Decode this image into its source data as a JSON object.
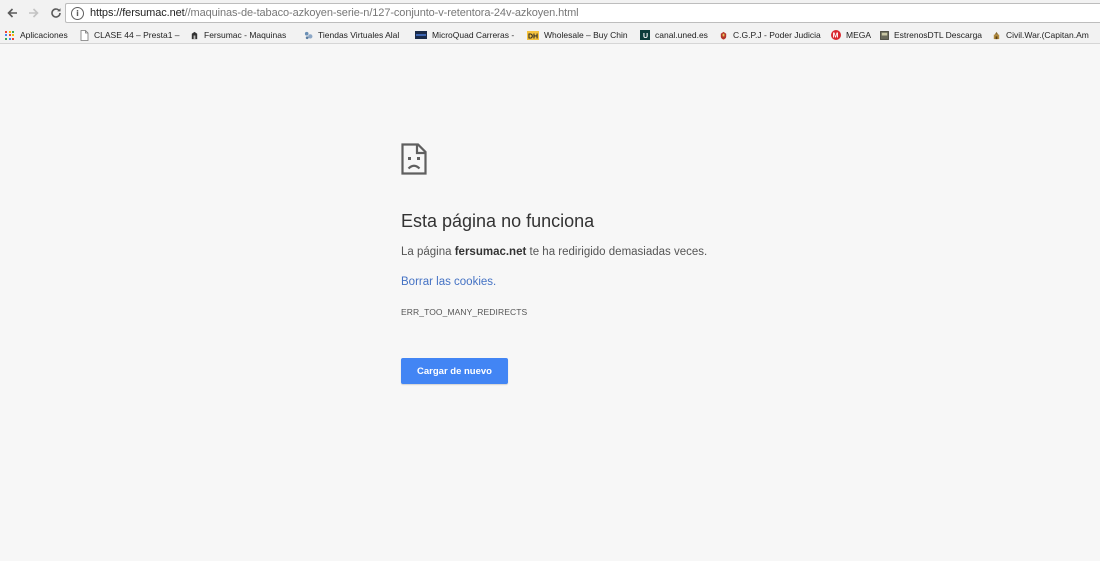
{
  "browser": {
    "back_icon": "arrow-left-icon",
    "forward_icon": "arrow-right-icon",
    "reload_icon": "reload-icon",
    "info_icon": "info-circle-icon",
    "url_host": "https://fersumac.net",
    "url_path": "//maquinas-de-tabaco-azkoyen-serie-n/127-conjunto-v-retentora-24v-azkoyen.html"
  },
  "bookmarks": {
    "items": [
      {
        "label": "Aplicaciones",
        "icon": "apps-grid-icon"
      },
      {
        "label": "CLASE 44 – Presta1 –",
        "icon": "page-icon"
      },
      {
        "label": "Fersumac - Maquinas",
        "icon": "site-icon"
      },
      {
        "label": "Tiendas Virtuales Alal",
        "icon": "site-icon"
      },
      {
        "label": "MicroQuad Carreras -",
        "icon": "site-icon"
      },
      {
        "label": "Wholesale – Buy Chin",
        "icon": "dh-icon"
      },
      {
        "label": "canal.uned.es",
        "icon": "uned-icon"
      },
      {
        "label": "C.G.P.J - Poder Judicia",
        "icon": "cgpj-icon"
      },
      {
        "label": "MEGA",
        "icon": "mega-icon"
      },
      {
        "label": "EstrenosDTL Descarga",
        "icon": "site-icon"
      },
      {
        "label": "Civil.War.(Capitan.Am",
        "icon": "site-icon"
      }
    ]
  },
  "error_page": {
    "icon": "sad-page-icon",
    "title": "Esta página no funciona",
    "description_prefix": "La página ",
    "description_host": "fersumac.net",
    "description_suffix": " te ha redirigido demasiadas veces.",
    "link": "Borrar las cookies.",
    "error_code": "ERR_TOO_MANY_REDIRECTS",
    "reload_button": "Cargar de nuevo"
  },
  "colors": {
    "button_blue": "#4285f4",
    "link_blue": "#4472c4",
    "page_bg": "#f7f7f7"
  }
}
